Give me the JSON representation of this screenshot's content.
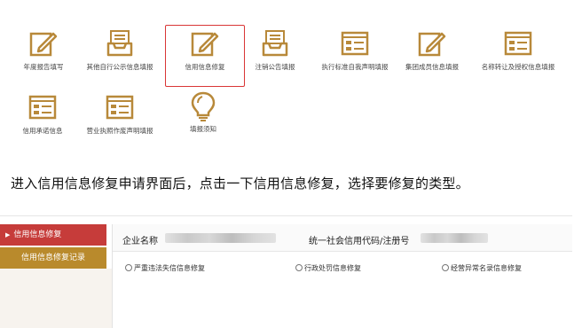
{
  "tiles": [
    {
      "label": "年度报告填写",
      "icon": "pencil-square-icon"
    },
    {
      "label": "其他自行公示信息填报",
      "icon": "inbox-tray-icon"
    },
    {
      "label": "信用信息修复",
      "icon": "pencil-square-icon"
    },
    {
      "label": "注销公告填报",
      "icon": "inbox-tray-icon"
    },
    {
      "label": "执行标准自我声明填报",
      "icon": "document-form-icon"
    },
    {
      "label": "集团成员信息填报",
      "icon": "pencil-square-icon"
    },
    {
      "label": "名称转让及授权信息填报",
      "icon": "document-form-icon"
    },
    {
      "label": "信用承诺信息",
      "icon": "document-form-icon"
    },
    {
      "label": "营业执照作废声明填报",
      "icon": "document-form-icon"
    },
    {
      "label": "填报须知",
      "icon": "lightbulb-icon"
    }
  ],
  "selected_tile": "信用信息修复",
  "caption": "进入信用信息修复申请界面后，点击一下信用信息修复，选择要修复的类型。",
  "sidebar": {
    "active": "信用信息修复",
    "secondary": "信用信息修复记录",
    "active_marker": "▶"
  },
  "header": {
    "company_label": "企业名称",
    "code_label": "统一社会信用代码/注册号"
  },
  "options": [
    "严重违法失信信息修复",
    "行政处罚信息修复",
    "经营异常名录信息修复"
  ],
  "colors": {
    "icon": "#b8893a",
    "selected_border": "#d93636",
    "sidebar_active": "#c63c3a",
    "sidebar_secondary": "#b98a2c"
  }
}
